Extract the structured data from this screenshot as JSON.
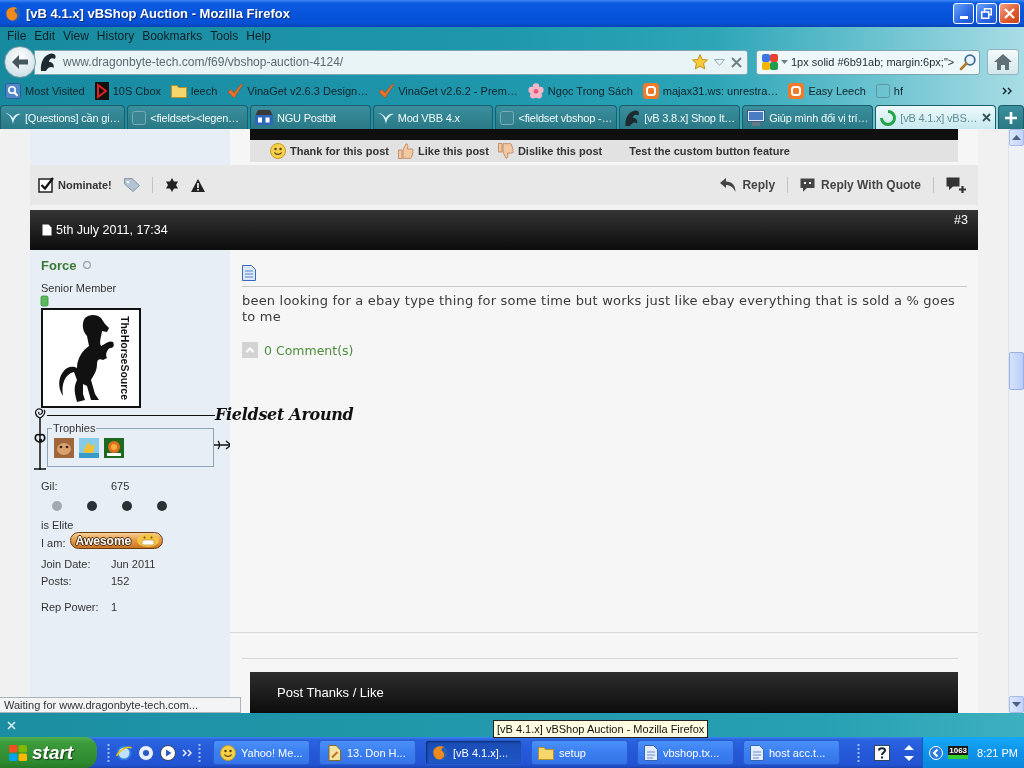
{
  "window": {
    "title": "[vB 4.1.x] vBShop Auction - Mozilla Firefox"
  },
  "menu": [
    "File",
    "Edit",
    "View",
    "History",
    "Bookmarks",
    "Tools",
    "Help"
  ],
  "navigation": {
    "url": "www.dragonbyte-tech.com/f69/vbshop-auction-4124/",
    "bookmarked": true,
    "search": {
      "value": "1px solid #6b91ab; margin:6px;\">"
    }
  },
  "bookmarks": [
    {
      "label": "Most Visited",
      "kind": "smart"
    },
    {
      "label": "10S Cbox",
      "kind": "logo"
    },
    {
      "label": "leech",
      "kind": "folder"
    },
    {
      "label": "VinaGet v2.6.3 Design…",
      "kind": "check"
    },
    {
      "label": "VinaGet v2.6.2 - Prem…",
      "kind": "check"
    },
    {
      "label": "Ngọc Trong Sách",
      "kind": "flower"
    },
    {
      "label": "majax31.ws: unrestra…",
      "kind": "blog"
    },
    {
      "label": "Easy Leech",
      "kind": "blog"
    },
    {
      "label": "hf",
      "kind": "page"
    }
  ],
  "tabs": [
    {
      "label": "[Questions] cần gi…",
      "kind": "bird",
      "selected": false
    },
    {
      "label": "<fieldset><legen…",
      "kind": "blank",
      "selected": false
    },
    {
      "label": "NGU Postbit",
      "kind": "badge",
      "selected": false
    },
    {
      "label": "Mod VBB 4.x",
      "kind": "bird",
      "selected": false
    },
    {
      "label": "<fieldset vbshop -…",
      "kind": "blank",
      "selected": false
    },
    {
      "label": "[vB 3.8.x] Shop It…",
      "kind": "dragon",
      "selected": false
    },
    {
      "label": "Giúp mình đổi vị trí…",
      "kind": "computer",
      "selected": false
    },
    {
      "label": "[vB 4.1.x] vBS…",
      "kind": "loading",
      "selected": true
    }
  ],
  "previous_post": {
    "buttons": [
      {
        "label": "Thank for this post",
        "kind": "thank"
      },
      {
        "label": "Like this post",
        "kind": "like"
      },
      {
        "label": "Dislike this post",
        "kind": "dislike"
      },
      {
        "label": "Test the custom button feature",
        "kind": "plain"
      }
    ]
  },
  "post_actions": {
    "nominate": {
      "label": "Nominate!",
      "checked": true
    },
    "buttons": [
      {
        "label": "Reply",
        "kind": "reply"
      },
      {
        "label": "Reply With Quote",
        "kind": "quote"
      }
    ]
  },
  "post": {
    "date": "5th July 2011, 17:34",
    "number": "#3",
    "user": {
      "name": "Force",
      "online": false,
      "title": "Senior Member",
      "avatar_caption": "TheHorseSource",
      "fieldset_legend": "Fieldset Around",
      "trophies_legend": "Trophies",
      "gil": {
        "label": "Gil:",
        "value": "675"
      },
      "dots": [
        {
          "color": "#a2a9b0"
        },
        {
          "color": "#2c3136"
        },
        {
          "color": "#2c3136"
        },
        {
          "color": "#2c3136"
        }
      ],
      "elite": "is Elite",
      "mood": {
        "label": "I am:",
        "badge": "Awesome"
      },
      "stats": [
        {
          "label": "Join Date:",
          "value": "Jun 2011"
        },
        {
          "label": "Posts:",
          "value": "152"
        },
        {
          "label": "Rep Power:",
          "value": "1"
        }
      ]
    },
    "message": "been looking for a ebay type thing for some time but works just like ebay everything that is sold a % goes to me",
    "comments": "0 Comment(s)",
    "thanks_title": "Post Thanks / Like"
  },
  "status_bar": {
    "text": "Waiting for www.dragonbyte-tech.com..."
  },
  "tooltip": "[vB 4.1.x] vBShop Auction - Mozilla Firefox",
  "taskbar": {
    "start": "start",
    "tasks": [
      {
        "label": "Yahoo! Me...",
        "kind": "smiley",
        "selected": false
      },
      {
        "label": "13. Don H...",
        "kind": "music",
        "selected": false
      },
      {
        "label": "[vB 4.1.x]...",
        "kind": "browser",
        "selected": true
      },
      {
        "label": "setup",
        "kind": "folder",
        "selected": false
      },
      {
        "label": "vbshop.tx...",
        "kind": "document",
        "selected": false
      },
      {
        "label": "host acc.t...",
        "kind": "document",
        "selected": false
      }
    ],
    "tray_counter": "1063",
    "clock": "8:21 PM"
  }
}
